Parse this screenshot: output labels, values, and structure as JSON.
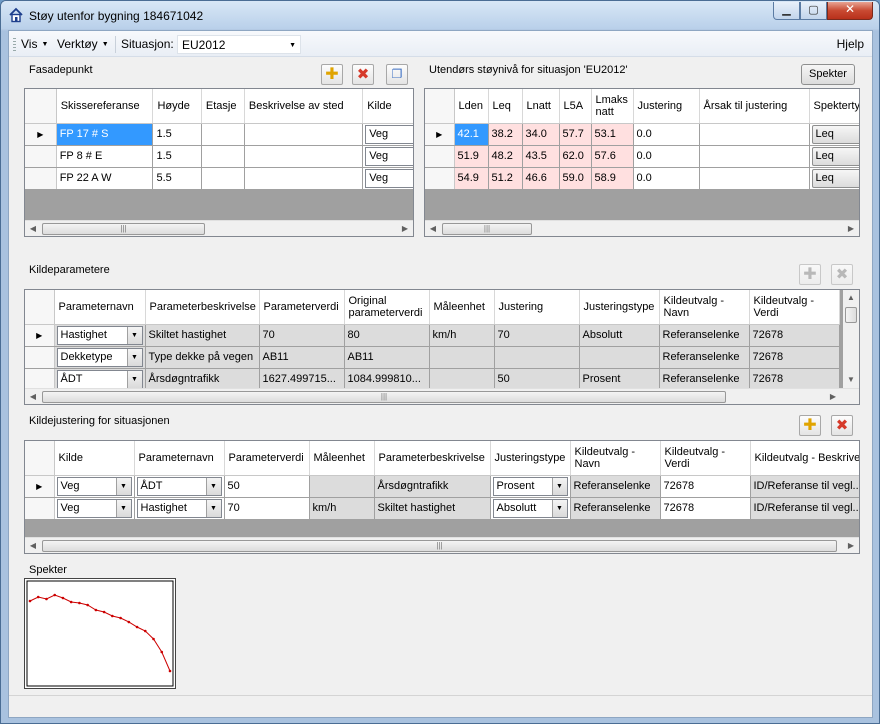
{
  "window": {
    "title": "Støy utenfor bygning 184671042",
    "icon": "house-icon",
    "buttons": {
      "minimize": "minimize-icon",
      "maximize": "maximize-icon",
      "close": "close-icon"
    }
  },
  "menubar": {
    "vis": "Vis",
    "verktoy": "Verktøy",
    "situasjon_label": "Situasjon:",
    "situasjon_value": "EU2012",
    "hjelp": "Hjelp"
  },
  "fasadepunkt": {
    "title": "Fasadepunkt",
    "columns": [
      "Skissereferanse",
      "Høyde",
      "Etasje",
      "Beskrivelse av sted",
      "Kilde"
    ],
    "rows": [
      {
        "skisse": "FP 17 # S",
        "hoyde": "1.5",
        "etasje": "",
        "beskrivelse": "",
        "kilde": "Veg"
      },
      {
        "skisse": "FP 8 # E",
        "hoyde": "1.5",
        "etasje": "",
        "beskrivelse": "",
        "kilde": "Veg"
      },
      {
        "skisse": "FP 22 A W",
        "hoyde": "5.5",
        "etasje": "",
        "beskrivelse": "",
        "kilde": "Veg"
      }
    ],
    "toolbar": {
      "add": "add-icon",
      "delete": "delete-icon",
      "copy": "copy-icon"
    }
  },
  "utendors": {
    "title": "Utendørs støynivå for situasjon 'EU2012'",
    "spekter_button": "Spekter",
    "columns": [
      "Lden",
      "Leq",
      "Lnatt",
      "L5A",
      "Lmaks natt",
      "Justering",
      "Årsak til justering",
      "Spektertyp"
    ],
    "rows": [
      {
        "lden": "42.1",
        "leq": "38.2",
        "lnatt": "34.0",
        "l5a": "57.7",
        "lmaks": "53.1",
        "justering": "0.0",
        "arsak": "",
        "spekter": "Leq"
      },
      {
        "lden": "51.9",
        "leq": "48.2",
        "lnatt": "43.5",
        "l5a": "62.0",
        "lmaks": "57.6",
        "justering": "0.0",
        "arsak": "",
        "spekter": "Leq"
      },
      {
        "lden": "54.9",
        "leq": "51.2",
        "lnatt": "46.6",
        "l5a": "59.0",
        "lmaks": "58.9",
        "justering": "0.0",
        "arsak": "",
        "spekter": "Leq"
      }
    ]
  },
  "kildeparametere": {
    "title": "Kildeparametere",
    "columns": [
      "Parameternavn",
      "Parameterbeskrivelse",
      "Parameterverdi",
      "Original parameterverdi",
      "Måleenhet",
      "Justering",
      "Justeringstype",
      "Kildeutvalg - Navn",
      "Kildeutvalg - Verdi"
    ],
    "rows": [
      {
        "navn": "Hastighet",
        "beskrivelse": "Skiltet hastighet",
        "verdi": "70",
        "original": "80",
        "enhet": "km/h",
        "justering": "70",
        "type": "Absolutt",
        "utvalg_navn": "Referanselenke",
        "utvalg_verdi": "72678"
      },
      {
        "navn": "Dekketype",
        "beskrivelse": "Type dekke på vegen",
        "verdi": "AB11",
        "original": "AB11",
        "enhet": "",
        "justering": "",
        "type": "",
        "utvalg_navn": "Referanselenke",
        "utvalg_verdi": "72678"
      },
      {
        "navn": "ÅDT",
        "beskrivelse": "Årsdøgntrafikk",
        "verdi": "1627.499715...",
        "original": "1084.999810...",
        "enhet": "",
        "justering": "50",
        "type": "Prosent",
        "utvalg_navn": "Referanselenke",
        "utvalg_verdi": "72678"
      }
    ]
  },
  "kildejustering": {
    "title": "Kildejustering for situasjonen",
    "columns": [
      "Kilde",
      "Parameternavn",
      "Parameterverdi",
      "Måleenhet",
      "Parameterbeskrivelse",
      "Justeringstype",
      "Kildeutvalg - Navn",
      "Kildeutvalg - Verdi",
      "Kildeutvalg - Beskrivelse"
    ],
    "rows": [
      {
        "kilde": "Veg",
        "navn": "ÅDT",
        "verdi": "50",
        "enhet": "",
        "beskrivelse": "Årsdøgntrafikk",
        "type": "Prosent",
        "utvalg_navn": "Referanselenke",
        "utvalg_verdi": "72678",
        "utvalg_besk": "ID/Referanse til vegl..."
      },
      {
        "kilde": "Veg",
        "navn": "Hastighet",
        "verdi": "70",
        "enhet": "km/h",
        "beskrivelse": "Skiltet hastighet",
        "type": "Absolutt",
        "utvalg_navn": "Referanselenke",
        "utvalg_verdi": "72678",
        "utvalg_besk": "ID/Referanse til vegl..."
      }
    ]
  },
  "spekter": {
    "title": "Spekter",
    "curve": [
      0.18,
      0.14,
      0.16,
      0.12,
      0.15,
      0.19,
      0.2,
      0.22,
      0.27,
      0.29,
      0.33,
      0.35,
      0.39,
      0.44,
      0.48,
      0.56,
      0.69,
      0.88
    ],
    "color": "#cc0000"
  },
  "colors": {
    "selection": "#3399ff",
    "level_highlight": "#ffe0e0"
  }
}
